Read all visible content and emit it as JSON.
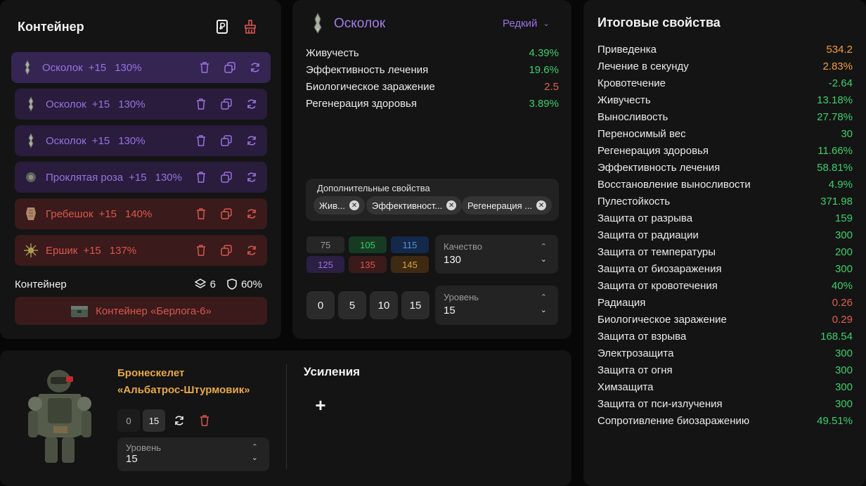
{
  "container": {
    "title": "Контейнер",
    "items": [
      {
        "name": "Осколок",
        "bonus": "+15",
        "percent": "130%",
        "tone": "purple"
      },
      {
        "name": "Осколок",
        "bonus": "+15",
        "percent": "130%",
        "tone": "purple"
      },
      {
        "name": "Осколок",
        "bonus": "+15",
        "percent": "130%",
        "tone": "purple"
      },
      {
        "name": "Проклятая роза",
        "bonus": "+15",
        "percent": "130%",
        "tone": "purple"
      },
      {
        "name": "Гребешок",
        "bonus": "+15",
        "percent": "140%",
        "tone": "red"
      },
      {
        "name": "Ершик",
        "bonus": "+15",
        "percent": "137%",
        "tone": "red"
      }
    ],
    "footer_label": "Контейнер",
    "slots": "6",
    "protection": "60%",
    "container_button": "Контейнер «Берлога-6»"
  },
  "artifact": {
    "name": "Осколок",
    "rarity": "Редкий",
    "properties": [
      {
        "label": "Живучесть",
        "value": "4.39%",
        "color": "#3fcf6a"
      },
      {
        "label": "Эффективность лечения",
        "value": "19.6%",
        "color": "#3fcf6a"
      },
      {
        "label": "Биологическое заражение",
        "value": "2.5",
        "color": "#e0604f"
      },
      {
        "label": "Регенерация здоровья",
        "value": "3.89%",
        "color": "#3fcf6a"
      }
    ],
    "extra_title": "Дополнительные свойства",
    "extra_chips": [
      "Жив...",
      "Эффективност...",
      "Регенерация ..."
    ],
    "quality_buttons": [
      "75",
      "105",
      "115",
      "125",
      "135",
      "145"
    ],
    "quality_label": "Качество",
    "quality_value": "130",
    "level_buttons": [
      "0",
      "5",
      "10",
      "15"
    ],
    "level_label": "Уровень",
    "level_value": "15"
  },
  "stats": {
    "title": "Итоговые свойства",
    "rows": [
      {
        "label": "Приведенка",
        "value": "534.2",
        "color": "#f0a040"
      },
      {
        "label": "Лечение в секунду",
        "value": "2.83%",
        "color": "#f0a040"
      },
      {
        "label": "Кровотечение",
        "value": "-2.64",
        "color": "#3fcf6a"
      },
      {
        "label": "Живучесть",
        "value": "13.18%",
        "color": "#3fcf6a"
      },
      {
        "label": "Выносливость",
        "value": "27.78%",
        "color": "#3fcf6a"
      },
      {
        "label": "Переносимый вес",
        "value": "30",
        "color": "#3fcf6a"
      },
      {
        "label": "Регенерация здоровья",
        "value": "11.66%",
        "color": "#3fcf6a"
      },
      {
        "label": "Эффективность лечения",
        "value": "58.81%",
        "color": "#3fcf6a"
      },
      {
        "label": "Восстановление выносливости",
        "value": "4.9%",
        "color": "#3fcf6a"
      },
      {
        "label": "Пулестойкость",
        "value": "371.98",
        "color": "#3fcf6a"
      },
      {
        "label": "Защита от разрыва",
        "value": "159",
        "color": "#3fcf6a"
      },
      {
        "label": "Защита от радиации",
        "value": "300",
        "color": "#3fcf6a"
      },
      {
        "label": "Защита от температуры",
        "value": "200",
        "color": "#3fcf6a"
      },
      {
        "label": "Защита от биозаражения",
        "value": "300",
        "color": "#3fcf6a"
      },
      {
        "label": "Защита от кровотечения",
        "value": "40%",
        "color": "#3fcf6a"
      },
      {
        "label": "Радиация",
        "value": "0.26",
        "color": "#e0604f"
      },
      {
        "label": "Биологическое заражение",
        "value": "0.29",
        "color": "#e0604f"
      },
      {
        "label": "Защита от взрыва",
        "value": "168.54",
        "color": "#3fcf6a"
      },
      {
        "label": "Электрозащита",
        "value": "300",
        "color": "#3fcf6a"
      },
      {
        "label": "Защита от огня",
        "value": "300",
        "color": "#3fcf6a"
      },
      {
        "label": "Химзащита",
        "value": "300",
        "color": "#3fcf6a"
      },
      {
        "label": "Защита от пси-излучения",
        "value": "300",
        "color": "#3fcf6a"
      },
      {
        "label": "Сопротивление биозаражению",
        "value": "49.51%",
        "color": "#3fcf6a"
      }
    ]
  },
  "armor": {
    "name_line1": "Бронескелет",
    "name_line2": "«Альбатрос-Штурмовик»",
    "level_buttons": [
      "0",
      "15"
    ],
    "level_label": "Уровень",
    "level_value": "15",
    "upgrades_title": "Усиления",
    "add_symbol": "+"
  },
  "colors": {
    "purple": "#9a72e0",
    "red": "#d9574f",
    "green": "#3fcf6a",
    "orange": "#f0a040"
  }
}
